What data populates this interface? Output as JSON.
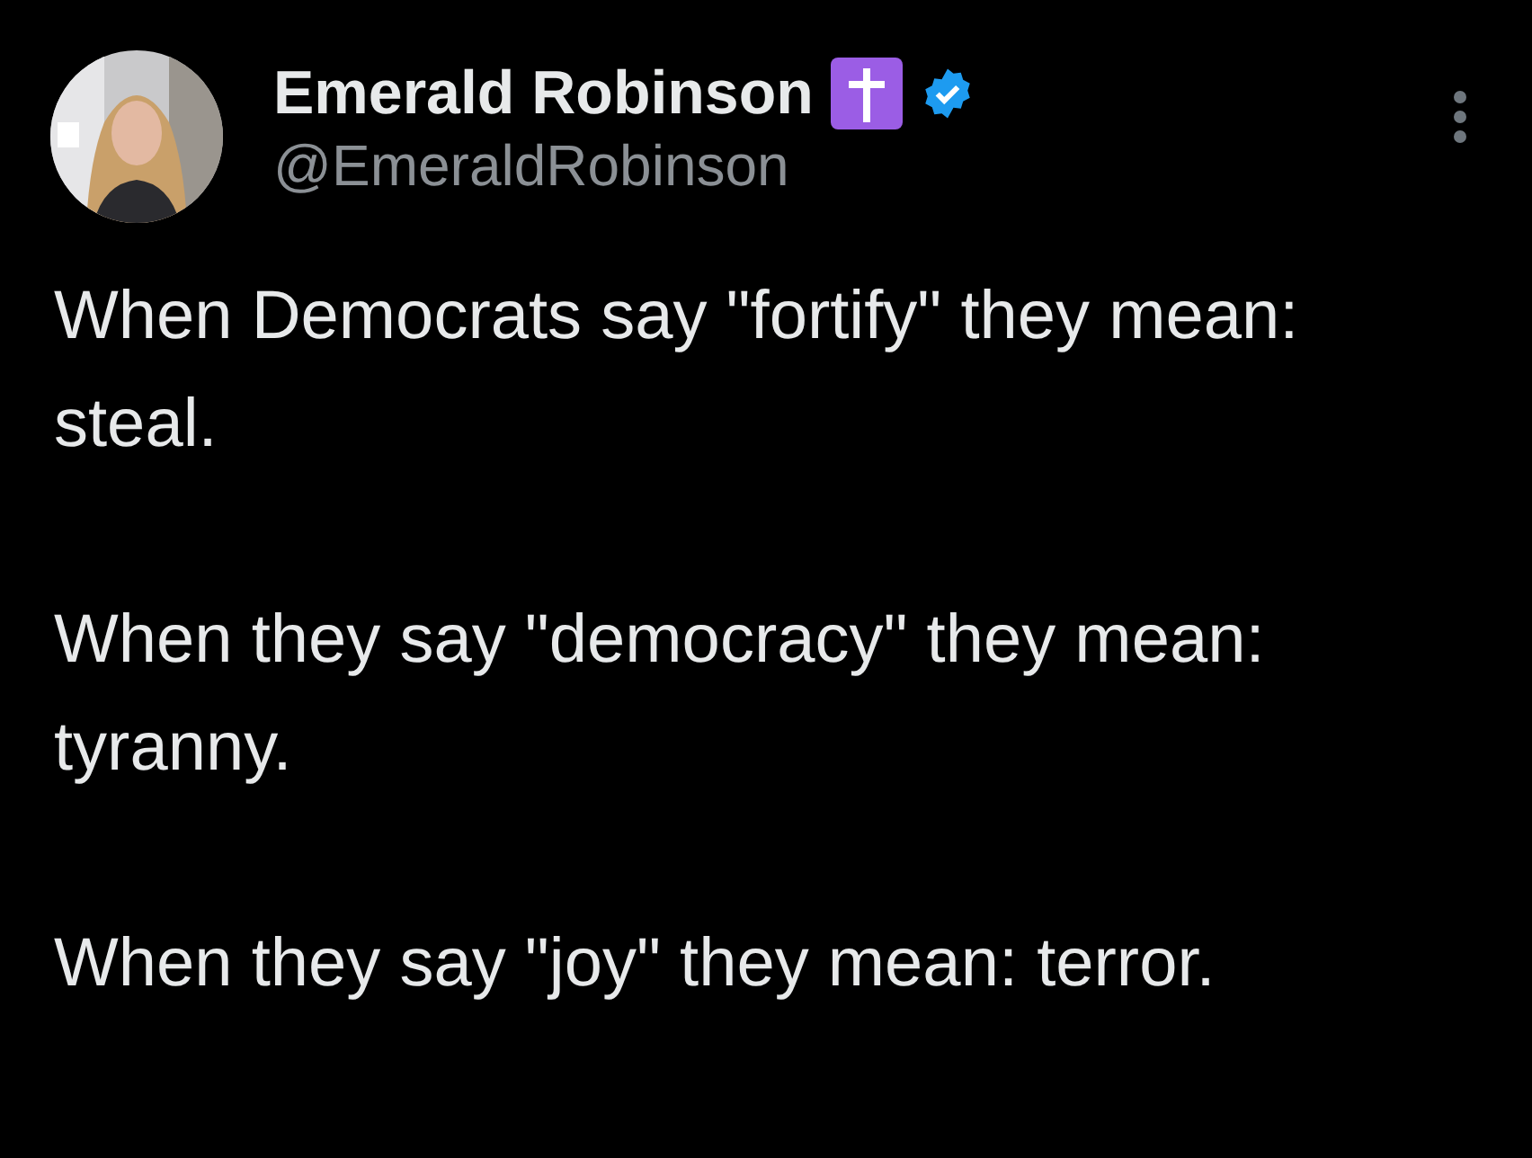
{
  "author": {
    "name": "Emerald Robinson",
    "handle": "@EmeraldRobinson",
    "verified": true
  },
  "paragraphs": [
    "When Democrats say \"fortify\" they mean: steal.",
    "When they say \"democracy\" they mean: tyranny.",
    "When they say \"joy\" they mean: terror."
  ]
}
